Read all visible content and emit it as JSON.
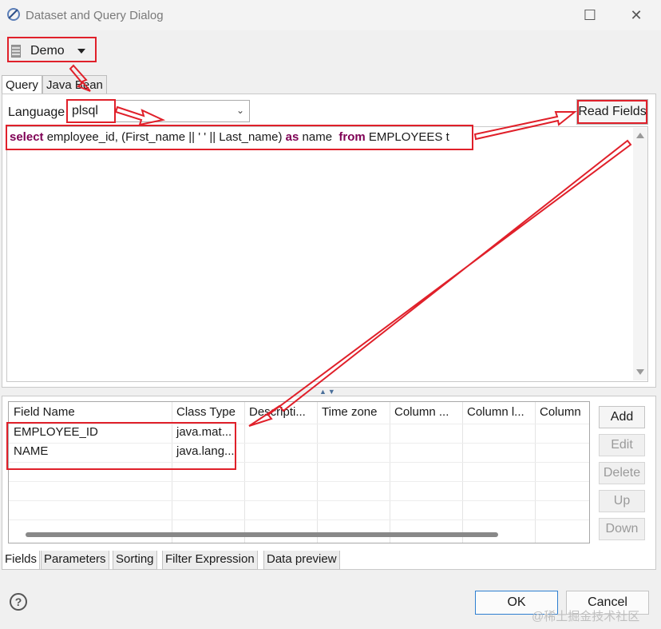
{
  "window": {
    "title": "Dataset and Query Dialog",
    "maximize_glyph": "☐",
    "close_glyph": "✕",
    "icon": "eclipse-dialog-icon"
  },
  "datasource": {
    "label": "Demo",
    "icon": "database-icon"
  },
  "top_tabs": [
    {
      "label": "Query",
      "active": true
    },
    {
      "label": "Java Bean",
      "active": false
    }
  ],
  "query": {
    "language_label": "Language",
    "language_value": "plsql",
    "read_fields_label": "Read Fields",
    "sql": {
      "kw_select": "select",
      "part1": " employee_id, (First_name || ' ' || Last_name) ",
      "kw_as": "as",
      "part2": " name  ",
      "kw_from": "from",
      "part3": " EMPLOYEES t"
    }
  },
  "fields_table": {
    "columns": [
      "Field Name",
      "Class Type",
      "Descripti...",
      "Time zone",
      "Column ...",
      "Column l...",
      "Column"
    ],
    "rows": [
      [
        "EMPLOYEE_ID",
        "java.mat..."
      ],
      [
        "NAME",
        "java.lang..."
      ]
    ]
  },
  "side_buttons": {
    "add": "Add",
    "edit": "Edit",
    "delete": "Delete",
    "up": "Up",
    "down": "Down"
  },
  "bottom_tabs": [
    {
      "label": "Fields",
      "active": true
    },
    {
      "label": "Parameters",
      "active": false
    },
    {
      "label": "Sorting",
      "active": false
    },
    {
      "label": "Filter Expression",
      "active": false
    },
    {
      "label": "Data preview",
      "active": false
    }
  ],
  "footer": {
    "help_glyph": "?",
    "ok_label": "OK",
    "cancel_label": "Cancel",
    "watermark": "@稀土掘金技术社区"
  },
  "colors": {
    "annotation": "#e0202a",
    "keyword": "#7f0055",
    "ok_border": "#2e7fd1"
  }
}
